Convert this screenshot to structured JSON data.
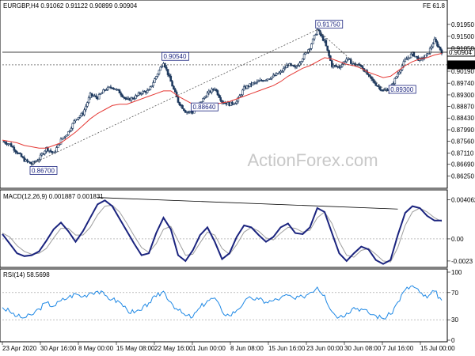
{
  "title": "EURGBP,H4  0.91062 0.91122 0.90899 0.90904",
  "corner_label": "FE 61.8",
  "watermark": "ActionForex.com",
  "colors": {
    "candle": "#1f3a5f",
    "ma": "#e53935",
    "macd": "#1a237e",
    "signal": "#9e9e9e",
    "rsi": "#1e88e5",
    "annotation_box": "#1a237e",
    "grid": "#cccccc"
  },
  "chart_data": [
    {
      "type": "candlestick",
      "panel": "price",
      "ylim": [
        0.8585,
        0.9245
      ],
      "yticks": [
        "0.91950",
        "0.91500",
        "0.91050",
        "0.90190",
        "0.89740",
        "0.89300",
        "0.88870",
        "0.88430",
        "0.87990",
        "0.87560",
        "0.87110",
        "0.86690",
        "0.86250",
        "0.85810"
      ],
      "xticks": [
        "23 Apr 2020",
        "30 Apr 16:00",
        "8 May 00:00",
        "15 May 08:00",
        "22 May 16:00",
        "1 Jun 00:00",
        "8 Jun 08:00",
        "15 Jun 16:00",
        "23 Jun 00:00",
        "30 Jun 08:00",
        "7 Jul 16:00",
        "15 Jul 00:00"
      ],
      "price_path": [
        0.8755,
        0.8745,
        0.8715,
        0.8685,
        0.867,
        0.869,
        0.873,
        0.871,
        0.876,
        0.879,
        0.884,
        0.886,
        0.893,
        0.892,
        0.895,
        0.896,
        0.894,
        0.891,
        0.892,
        0.894,
        0.8945,
        0.9,
        0.9054,
        0.898,
        0.8905,
        0.8868,
        0.8864,
        0.89,
        0.8935,
        0.8955,
        0.8905,
        0.8895,
        0.8905,
        0.8955,
        0.897,
        0.898,
        0.899,
        0.9,
        0.9015,
        0.9045,
        0.903,
        0.907,
        0.911,
        0.9175,
        0.913,
        0.904,
        0.9035,
        0.9065,
        0.9045,
        0.904,
        0.9,
        0.897,
        0.8945,
        0.8955,
        0.901,
        0.906,
        0.9085,
        0.906,
        0.908,
        0.9135,
        0.9092
      ],
      "moving_average": [
        0.876,
        0.8755,
        0.875,
        0.874,
        0.8735,
        0.873,
        0.873,
        0.874,
        0.875,
        0.877,
        0.879,
        0.8815,
        0.884,
        0.886,
        0.8875,
        0.889,
        0.8895,
        0.8895,
        0.8905,
        0.8915,
        0.8925,
        0.8935,
        0.8945,
        0.8945,
        0.8925,
        0.891,
        0.8895,
        0.889,
        0.8895,
        0.8895,
        0.89,
        0.8905,
        0.8915,
        0.8925,
        0.8935,
        0.8945,
        0.8955,
        0.8965,
        0.898,
        0.9,
        0.9015,
        0.903,
        0.904,
        0.9055,
        0.907,
        0.9065,
        0.9055,
        0.9045,
        0.904,
        0.903,
        0.9015,
        0.9005,
        0.8995,
        0.9,
        0.902,
        0.904,
        0.9055,
        0.9065,
        0.907,
        0.908,
        0.9086
      ],
      "horizontal_levels": [
        {
          "value": 0.90904,
          "label": "0.90904",
          "style": "solid"
        },
        {
          "value": 0.9043,
          "label": "0.90430",
          "style": "dotted"
        }
      ],
      "annotations": [
        {
          "label": "0.86700",
          "x_index": 4,
          "y": 0.867
        },
        {
          "label": "0.90540",
          "x_index": 22,
          "y": 0.9054
        },
        {
          "label": "0.88640",
          "x_index": 26,
          "y": 0.8864
        },
        {
          "label": "0.91750",
          "x_index": 43,
          "y": 0.9175
        },
        {
          "label": "0.89300",
          "x_index": 53,
          "y": 0.893
        }
      ]
    },
    {
      "type": "line",
      "panel": "macd",
      "title": "MACD(12,26,9) 0.001887 0.001831",
      "ylim": [
        -0.0028,
        0.0046
      ],
      "yticks": [
        "0.004062",
        "0.00",
        "-0.0023"
      ],
      "macd": [
        0.0005,
        -0.0005,
        -0.0015,
        -0.0018,
        -0.0017,
        -0.0013,
        -0.0002,
        0.001,
        0.0017,
        0.0008,
        -0.0003,
        0.0008,
        0.0022,
        0.0036,
        0.004,
        0.0034,
        0.0021,
        0.0008,
        -0.0005,
        -0.0017,
        -0.0015,
        0.0006,
        0.0022,
        0.001,
        -0.0017,
        -0.0023,
        -0.0012,
        0.0004,
        0.0012,
        -0.0003,
        -0.0021,
        -0.0015,
        0.0002,
        0.0014,
        0.0012,
        0.0004,
        -0.0003,
        0.0002,
        0.0012,
        0.0016,
        0.0006,
        0.0005,
        0.0012,
        0.0032,
        0.0028,
        0.0006,
        -0.0015,
        -0.0023,
        -0.0015,
        -0.0008,
        -0.0011,
        -0.0022,
        -0.0026,
        -0.0022,
        0.0004,
        0.0027,
        0.0034,
        0.0032,
        0.0024,
        0.0019,
        0.0019
      ],
      "signal": [
        0.0006,
        0.0002,
        -0.0007,
        -0.0013,
        -0.0016,
        -0.0015,
        -0.001,
        0.0001,
        0.0011,
        0.0011,
        0.0004,
        0.0004,
        0.0012,
        0.0025,
        0.0034,
        0.0035,
        0.0028,
        0.0016,
        0.0003,
        -0.0009,
        -0.0014,
        -0.0005,
        0.001,
        0.0013,
        -0.0002,
        -0.0017,
        -0.0016,
        -0.0004,
        0.0007,
        0.0004,
        -0.001,
        -0.0016,
        -0.0006,
        0.0007,
        0.0012,
        0.0008,
        0.0001,
        -0.0001,
        0.0006,
        0.0012,
        0.0011,
        0.0007,
        0.0009,
        0.0022,
        0.0028,
        0.0016,
        -0.0003,
        -0.0017,
        -0.0019,
        -0.0012,
        -0.001,
        -0.0016,
        -0.0023,
        -0.0024,
        -0.0009,
        0.0014,
        0.0028,
        0.0032,
        0.0028,
        0.0022,
        0.0018
      ],
      "trendline": {
        "from_index": 13,
        "from": 0.0043,
        "to_index": 54,
        "to": 0.0031
      }
    },
    {
      "type": "line",
      "panel": "rsi",
      "title": "RSI(14) 58.5698",
      "ylim": [
        0,
        100
      ],
      "yticks": [
        "100",
        "70",
        "30",
        "0"
      ],
      "levels": [
        70,
        30
      ],
      "values": [
        48,
        42,
        35,
        33,
        37,
        46,
        55,
        50,
        58,
        63,
        68,
        64,
        70,
        72,
        66,
        60,
        56,
        45,
        40,
        44,
        55,
        64,
        72,
        56,
        44,
        36,
        34,
        48,
        58,
        62,
        42,
        36,
        44,
        56,
        62,
        60,
        56,
        58,
        62,
        66,
        60,
        64,
        70,
        78,
        66,
        42,
        34,
        40,
        48,
        46,
        40,
        36,
        32,
        38,
        56,
        74,
        80,
        70,
        62,
        72,
        58.6
      ]
    }
  ]
}
